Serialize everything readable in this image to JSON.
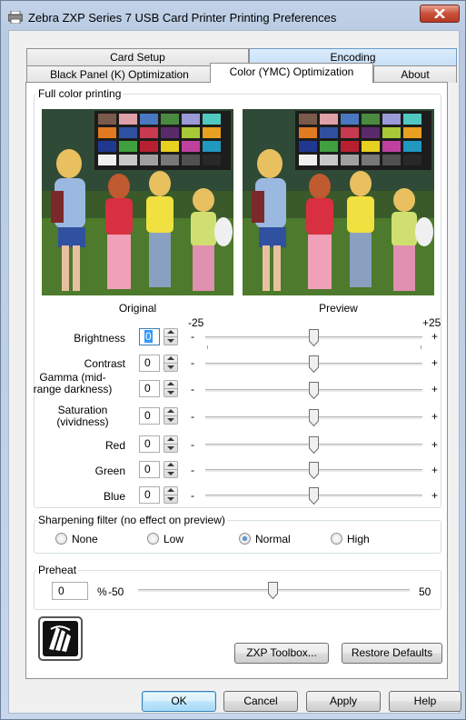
{
  "window": {
    "title": "Zebra ZXP Series 7 USB Card Printer Printing Preferences"
  },
  "tabs": {
    "upper": [
      "Card Setup",
      "Encoding"
    ],
    "lower": [
      "Black Panel (K) Optimization",
      "Color (YMC) Optimization",
      "About"
    ],
    "active": "Color (YMC) Optimization"
  },
  "full_color": {
    "legend": "Full color printing",
    "original_caption": "Original",
    "preview_caption": "Preview",
    "scale_min": "-25",
    "scale_max": "+25",
    "minus": "-",
    "plus": "+",
    "sliders": [
      {
        "label": "Brightness",
        "value": "0"
      },
      {
        "label": "Contrast",
        "value": "0"
      },
      {
        "label_line1": "Gamma (mid-",
        "label_line2": "range darkness)",
        "value": "0"
      },
      {
        "label_line1": "Saturation",
        "label_line2": "(vividness)",
        "value": "0"
      },
      {
        "label": "Red",
        "value": "0"
      },
      {
        "label": "Green",
        "value": "0"
      },
      {
        "label": "Blue",
        "value": "0"
      }
    ]
  },
  "sharpening": {
    "legend": "Sharpening filter (no effect on preview)",
    "options": [
      "None",
      "Low",
      "Normal",
      "High"
    ],
    "selected": "Normal"
  },
  "preheat": {
    "legend": "Preheat",
    "value": "0",
    "unit": "%",
    "min": "-50",
    "max": "50"
  },
  "panel_buttons": {
    "toolbox": "ZXP Toolbox...",
    "restore": "Restore Defaults"
  },
  "dialog_buttons": {
    "ok": "OK",
    "cancel": "Cancel",
    "apply": "Apply",
    "help": "Help"
  },
  "colors": {
    "accent": "#3399ff",
    "title_bar": "#b9cbe3",
    "close_button": "#c9503a"
  }
}
